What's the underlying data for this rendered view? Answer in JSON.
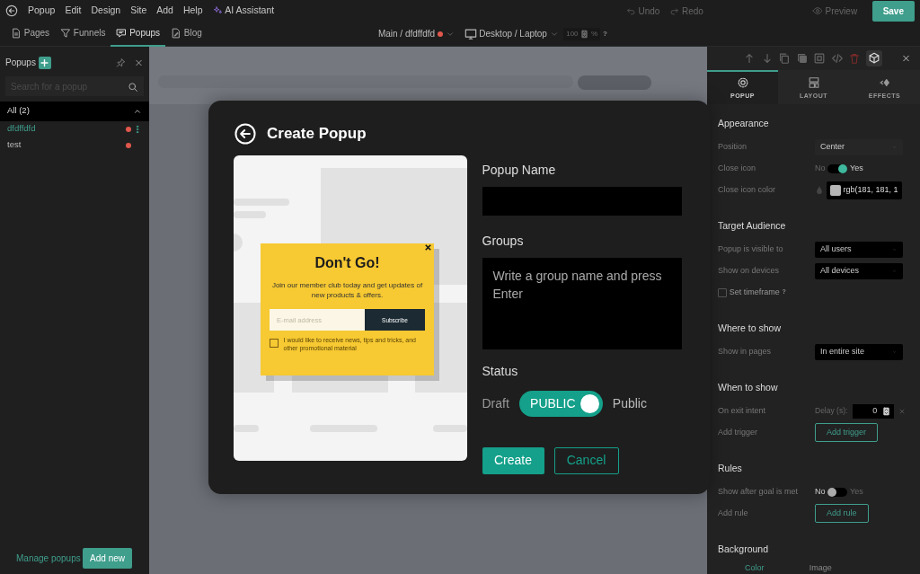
{
  "menu": {
    "items": [
      "Popup",
      "Edit",
      "Design",
      "Site",
      "Add",
      "Help"
    ],
    "ai_assistant": "AI Assistant",
    "undo": "Undo",
    "redo": "Redo",
    "preview": "Preview",
    "save": "Save"
  },
  "tabs": [
    {
      "label": "Pages",
      "kind": "page",
      "selected": false
    },
    {
      "label": "Funnels",
      "kind": "funnel",
      "selected": false
    },
    {
      "label": "Popups",
      "kind": "popup",
      "selected": true
    },
    {
      "label": "Blog",
      "kind": "blog",
      "selected": false
    }
  ],
  "page_selector": "Main / dfdffdfd",
  "device_selector": "Desktop / Laptop",
  "zoom": {
    "value": "100",
    "unit": "%",
    "help": "?"
  },
  "sidebar": {
    "title": "Popups",
    "search_placeholder": "Search for a popup",
    "group": {
      "label": "All (2)",
      "expanded": true
    },
    "items": [
      {
        "label": "dfdffdfd",
        "selected": true
      },
      {
        "label": "test",
        "selected": false
      }
    ],
    "manage_link": "Manage popups",
    "add_button": "Add new"
  },
  "modal": {
    "title": "Create Popup",
    "preview": {
      "heading": "Don't Go!",
      "body": "Join our member club today and get updates of new products & offers.",
      "email_placeholder": "E-mail address",
      "subscribe": "Subscribe",
      "consent": "I would like to receive news, tips and tricks, and other promotional material",
      "consent_checked": false
    },
    "name_label": "Popup Name",
    "groups_label": "Groups",
    "groups_placeholder": "Write a group name and press Enter",
    "status_label": "Status",
    "status_off": "Draft",
    "status_switch": {
      "label": "PUBLIC",
      "on": true
    },
    "status_on": "Public",
    "create": "Create",
    "cancel": "Cancel"
  },
  "panel": {
    "tabs": [
      {
        "label": "POPUP",
        "kind": "gear",
        "selected": true
      },
      {
        "label": "LAYOUT",
        "kind": "layout",
        "selected": false
      },
      {
        "label": "EFFECTS",
        "kind": "effects",
        "selected": false
      }
    ],
    "sections": [
      {
        "title": "Appearance",
        "rows": [
          {
            "kind": "select",
            "label": "Position",
            "value": "Center"
          },
          {
            "kind": "toggle",
            "label": "Close icon",
            "off_label": "No",
            "on_label": "Yes",
            "on": true
          },
          {
            "kind": "color",
            "label": "Close icon color",
            "value": "rgb(181, 181, 1"
          }
        ]
      },
      {
        "title": "Target Audience",
        "rows": [
          {
            "kind": "select",
            "label": "Popup is visible to",
            "value": "All users"
          },
          {
            "kind": "select",
            "label": "Show on devices",
            "value": "All devices"
          },
          {
            "kind": "checkbox",
            "label": "Set timeframe",
            "help": "?",
            "checked": false
          }
        ]
      },
      {
        "title": "Where to show",
        "rows": [
          {
            "kind": "select",
            "label": "Show in pages",
            "value": "In entire site"
          }
        ]
      },
      {
        "title": "When to show",
        "rows": [
          {
            "kind": "delay",
            "label": "On exit intent",
            "delay_label": "Delay (s):",
            "value": "0"
          },
          {
            "kind": "button",
            "label": "Add trigger",
            "button": "Add trigger"
          }
        ]
      },
      {
        "title": "Rules",
        "rows": [
          {
            "kind": "toggle",
            "label": "Show after goal is met",
            "off_label": "No",
            "on_label": "Yes",
            "on": false
          },
          {
            "kind": "button",
            "label": "Add rule",
            "button": "Add rule"
          }
        ]
      }
    ],
    "background": {
      "title": "Background",
      "tabs": [
        {
          "label": "Color",
          "selected": true
        },
        {
          "label": "Image",
          "selected": false
        }
      ]
    }
  }
}
